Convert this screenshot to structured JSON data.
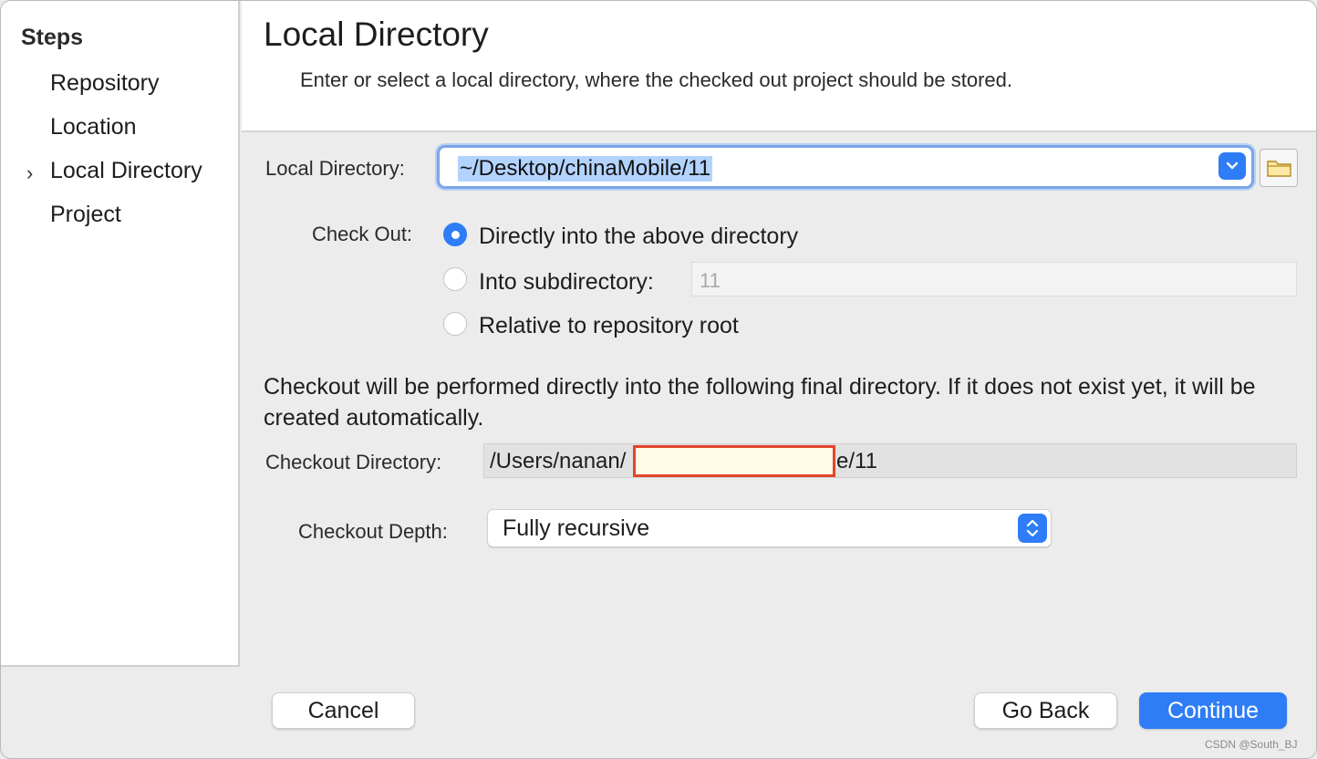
{
  "sidebar": {
    "title": "Steps",
    "current_marker": "›",
    "items": [
      {
        "label": "Repository"
      },
      {
        "label": "Location"
      },
      {
        "label": "Local Directory"
      },
      {
        "label": "Project"
      }
    ]
  },
  "header": {
    "title": "Local Directory",
    "description": "Enter or select a local directory, where the checked out project should be stored."
  },
  "form": {
    "local_directory_label": "Local Directory:",
    "local_directory_value": "~/Desktop/chinaMobile/11",
    "check_out_label": "Check Out:",
    "options": [
      {
        "label": "Directly into the above directory",
        "selected": true
      },
      {
        "label": "Into subdirectory:",
        "selected": false
      },
      {
        "label": "Relative to repository root",
        "selected": false
      }
    ],
    "subdirectory_value": "11",
    "info_text": "Checkout will be performed directly into the following final directory. If it does not exist yet, it will be created automatically.",
    "checkout_directory_label": "Checkout Directory:",
    "checkout_directory_prefix": "/Users/nanan/",
    "checkout_directory_suffix": "e/11",
    "checkout_depth_label": "Checkout Depth:",
    "checkout_depth_value": "Fully recursive"
  },
  "buttons": {
    "cancel": "Cancel",
    "go_back": "Go Back",
    "continue": "Continue"
  },
  "watermark": "CSDN @South_BJ",
  "colors": {
    "accent": "#2f7df6",
    "selection": "#b3d3ff",
    "redaction_border": "#e2452a",
    "redaction_fill": "#fffbe4"
  },
  "icons": [
    "folder-icon",
    "chevron-down-icon",
    "up-down-chevron-icon"
  ]
}
